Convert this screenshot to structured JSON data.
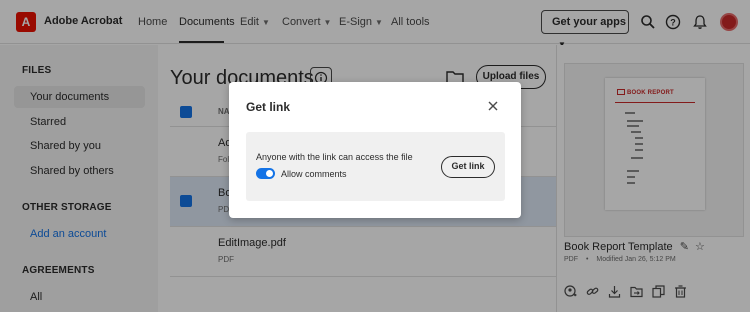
{
  "header": {
    "app_name": "Adobe Acrobat",
    "logo_glyph": "A",
    "nav": [
      {
        "label": "Home",
        "has_menu": false
      },
      {
        "label": "Documents",
        "has_menu": false,
        "active": true
      },
      {
        "label": "Edit",
        "has_menu": true
      },
      {
        "label": "Convert",
        "has_menu": true
      },
      {
        "label": "E-Sign",
        "has_menu": true
      },
      {
        "label": "All tools",
        "has_menu": false
      }
    ],
    "apps_button": "Get your apps",
    "icons": [
      "search-icon",
      "help-icon",
      "bell-icon",
      "avatar"
    ]
  },
  "sidebar": {
    "files_heading": "FILES",
    "files_items": [
      "Your documents",
      "Starred",
      "Shared by you",
      "Shared by others"
    ],
    "storage_heading": "OTHER STORAGE",
    "storage_link": "Add an account",
    "agreements_heading": "AGREEMENTS",
    "agreements_items": [
      "All"
    ]
  },
  "main": {
    "title": "Your documents",
    "upload_button": "Upload files",
    "column_header": "NA",
    "rows": [
      {
        "name": "Ad",
        "type": "Fol",
        "selected": false
      },
      {
        "name": "Bo",
        "type": "PDF",
        "selected": true
      },
      {
        "name": "EditImage.pdf",
        "type": "PDF",
        "selected": false
      }
    ]
  },
  "preview": {
    "thumb_title": "BOOK REPORT",
    "file_name": "Book Report Template",
    "file_type": "PDF",
    "meta_sep": "•",
    "modified": "Modified Jan 26, 5:12 PM",
    "actions": [
      "add-person-icon",
      "link-icon",
      "download-icon",
      "move-icon",
      "copy-icon",
      "trash-icon"
    ]
  },
  "dialog": {
    "title": "Get link",
    "description": "Anyone with the link can access the file",
    "toggle_label": "Allow comments",
    "toggle_on": true,
    "button": "Get link"
  },
  "colors": {
    "accent": "#1473e6",
    "brand": "#eb1000",
    "overlay": "rgba(0,0,0,0.35)"
  }
}
